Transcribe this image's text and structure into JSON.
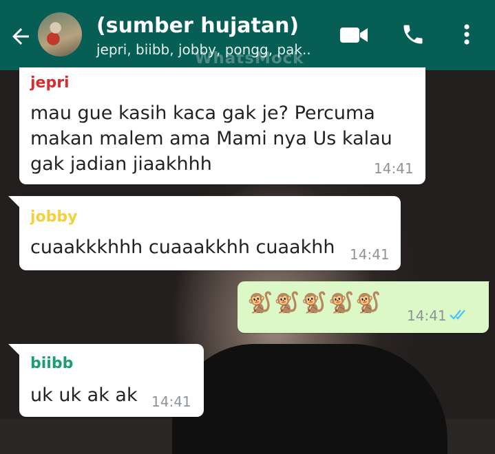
{
  "header": {
    "title": "(sumber hujatan)",
    "subtitle": "jepri, biibb, jobby, pongg, pak..",
    "watermark": "WhatsMock"
  },
  "messages": [
    {
      "sender": "jepri",
      "sender_color": "#d32f2f",
      "lines": [
        "mau gue kasih kaca gak je? Percuma",
        "makan malem ama Mami nya Us kalau",
        "gak jadian jiaakhhh"
      ],
      "time": "14:41",
      "direction": "incoming"
    },
    {
      "sender": "jobby",
      "sender_color": "#f4d03f",
      "lines": [
        "cuaakkkhhh cuaaakkhh cuaakhh"
      ],
      "time": "14:41",
      "direction": "incoming"
    },
    {
      "text": "🐒🐒🐒🐒🐒",
      "time": "14:41",
      "direction": "outgoing",
      "status": "read"
    },
    {
      "sender": "biibb",
      "sender_color": "#1a9e73",
      "lines": [
        "uk uk ak ak"
      ],
      "time": "14:41",
      "direction": "incoming"
    }
  ],
  "colors": {
    "header_bg": "#075e54",
    "outgoing_bg": "#dcf8c6",
    "read_ticks": "#4fc3f7"
  },
  "icons": [
    "back-arrow-icon",
    "video-call-icon",
    "phone-call-icon",
    "more-vert-icon",
    "double-check-icon"
  ]
}
